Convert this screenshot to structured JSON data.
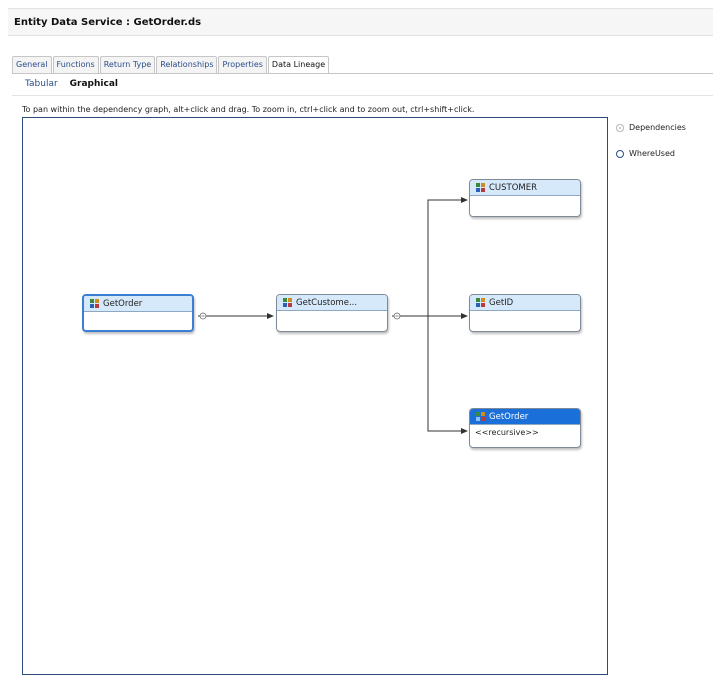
{
  "editor": {
    "title": "Entity Data Service : GetOrder.ds"
  },
  "tabs": [
    {
      "label": "General"
    },
    {
      "label": "Functions"
    },
    {
      "label": "Return Type"
    },
    {
      "label": "Relationships"
    },
    {
      "label": "Properties"
    },
    {
      "label": "Data Lineage",
      "active": true
    }
  ],
  "subtabs": [
    {
      "label": "Tabular"
    },
    {
      "label": "Graphical",
      "active": true
    }
  ],
  "instructions": "To pan within the dependency graph, alt+click and drag. To zoom in, ctrl+click and to zoom out, ctrl+shift+click.",
  "graph": {
    "nodes": {
      "root": {
        "label": "GetOrder",
        "body": ""
      },
      "middle": {
        "label": "GetCustome...",
        "body": ""
      },
      "customer": {
        "label": "CUSTOMER",
        "body": ""
      },
      "getid": {
        "label": "GetID",
        "body": ""
      },
      "recursive": {
        "label": "GetOrder",
        "body": "<<recursive>>"
      }
    },
    "colors": {
      "node_header": "#d6e9fb",
      "selected_border": "#3b7fd4",
      "highlight_header": "#1b6fd8",
      "panel_border": "#2e4a78"
    }
  },
  "view_options": [
    {
      "label": "Dependencies",
      "checked": true,
      "disabled": true
    },
    {
      "label": "WhereUsed",
      "checked": false,
      "disabled": false
    }
  ]
}
